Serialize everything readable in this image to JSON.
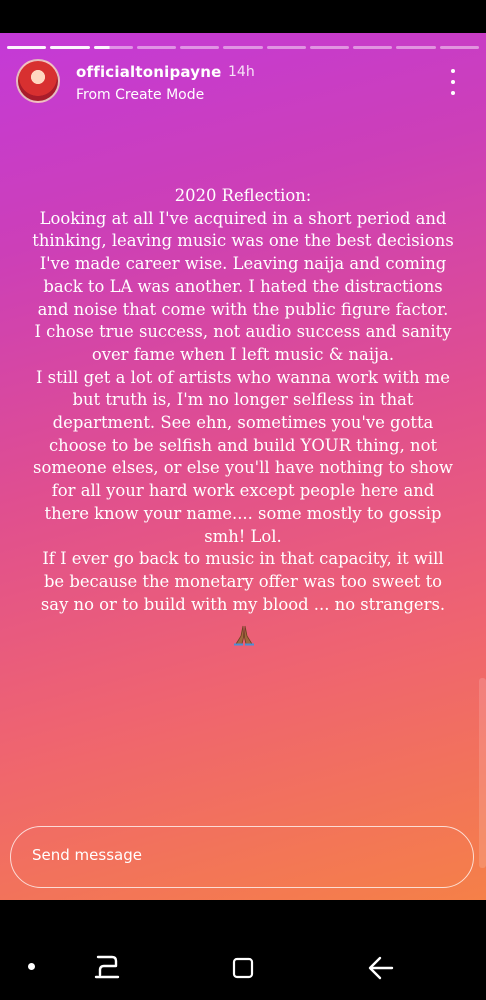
{
  "header": {
    "username": "officialtonipayne",
    "time": "14h",
    "subtitle": "From Create Mode",
    "progress": {
      "segments": 11,
      "current_index": 2,
      "current_fraction": 0.4
    }
  },
  "story": {
    "lines": [
      "2020 Reflection:",
      "Looking at all I've acquired in a short period and",
      "thinking, leaving music was one the best decisions",
      "I've made career wise. Leaving naija and coming",
      "back to LA was another. I hated the distractions",
      "and noise that come with the public figure factor.",
      "I chose true success, not audio success and sanity",
      "over fame when I left music & naija.",
      "I still get a lot of artists who wanna work with me",
      "but truth is, I'm no longer selfless in that",
      "department. See ehn, sometimes you've gotta",
      "choose to be selfish and build YOUR thing, not",
      "someone elses, or else you'll have nothing to show",
      "for all your hard work except people here and",
      "there know your name.... some mostly to gossip",
      "smh! Lol.",
      "If I ever go back to music in that capacity, it will",
      "be because the monetary offer was too sweet to",
      "say no or to build with my blood ... no strangers."
    ],
    "emoji": "folded-hands-icon"
  },
  "footer": {
    "send_placeholder": "Send message"
  },
  "colors": {
    "gradient_start": "#c43ad8",
    "gradient_mid": "#e04f8f",
    "gradient_end": "#f58048"
  },
  "nav": {
    "icons": [
      "nav-dot-icon",
      "recent-apps-icon",
      "home-icon",
      "back-icon"
    ]
  }
}
